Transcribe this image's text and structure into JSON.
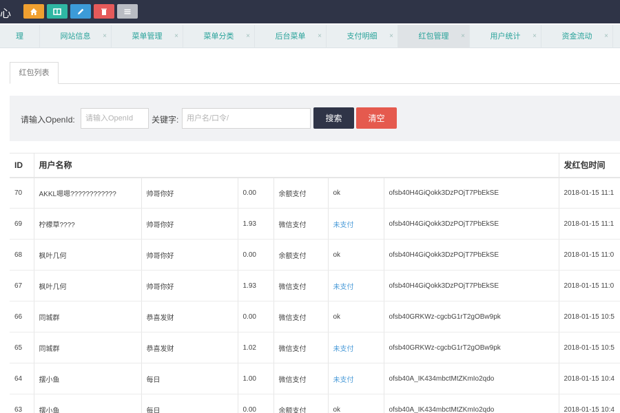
{
  "header": {
    "title": "心"
  },
  "quick_buttons": [
    {
      "icon": "home-icon",
      "color": "#f0a030"
    },
    {
      "icon": "grid-icon",
      "color": "#2fb7a3"
    },
    {
      "icon": "edit-icon",
      "color": "#3c9bd8"
    },
    {
      "icon": "trash-icon",
      "color": "#e55a5a"
    },
    {
      "icon": "menu-icon",
      "color": "#b9bcc3"
    }
  ],
  "tabs": [
    {
      "label": "理"
    },
    {
      "label": "网站信息"
    },
    {
      "label": "菜单管理"
    },
    {
      "label": "菜单分类"
    },
    {
      "label": "后台菜单"
    },
    {
      "label": "支付明细"
    },
    {
      "label": "红包管理",
      "active": true
    },
    {
      "label": "用户统计"
    },
    {
      "label": "资金流动"
    }
  ],
  "subtab": {
    "label": "红包列表"
  },
  "search": {
    "openid_label": "请输入OpenId:",
    "openid_placeholder": "请输入OpenId",
    "keyword_label": "关键字:",
    "keyword_placeholder": "用户名/口令/",
    "search_button": "搜索",
    "clear_button": "清空",
    "search_color": "#2f3447",
    "clear_color": "#e55a4e"
  },
  "table": {
    "headers": {
      "id": "ID",
      "username": "用户名称",
      "time": "发红包时间"
    },
    "rows": [
      {
        "id": "70",
        "username": "AKKL嗯嗯????????????",
        "greeting": "帅哥你好",
        "amount": "0.00",
        "payment": "余额支付",
        "status": "ok",
        "status_unpaid": false,
        "openid": "ofsb40H4GiQokk3DzPOjT7PbEkSE",
        "time": "2018-01-15 11:1"
      },
      {
        "id": "69",
        "username": "柠檬草????",
        "greeting": "帅哥你好",
        "amount": "1.93",
        "payment": "微信支付",
        "status": "未支付",
        "status_unpaid": true,
        "openid": "ofsb40H4GiQokk3DzPOjT7PbEkSE",
        "time": "2018-01-15 11:1"
      },
      {
        "id": "68",
        "username": "枫叶几何",
        "greeting": "帅哥你好",
        "amount": "0.00",
        "payment": "余额支付",
        "status": "ok",
        "status_unpaid": false,
        "openid": "ofsb40H4GiQokk3DzPOjT7PbEkSE",
        "time": "2018-01-15 11:0"
      },
      {
        "id": "67",
        "username": "枫叶几何",
        "greeting": "帅哥你好",
        "amount": "1.93",
        "payment": "微信支付",
        "status": "未支付",
        "status_unpaid": true,
        "openid": "ofsb40H4GiQokk3DzPOjT7PbEkSE",
        "time": "2018-01-15 11:0"
      },
      {
        "id": "66",
        "username": "同城群",
        "greeting": "恭喜发财",
        "amount": "0.00",
        "payment": "微信支付",
        "status": "ok",
        "status_unpaid": false,
        "openid": "ofsb40GRKWz-cgcbG1rT2gOBw9pk",
        "time": "2018-01-15 10:5"
      },
      {
        "id": "65",
        "username": "同城群",
        "greeting": "恭喜发财",
        "amount": "1.02",
        "payment": "微信支付",
        "status": "未支付",
        "status_unpaid": true,
        "openid": "ofsb40GRKWz-cgcbG1rT2gOBw9pk",
        "time": "2018-01-15 10:5"
      },
      {
        "id": "64",
        "username": "摆小鱼",
        "greeting": "每日",
        "amount": "1.00",
        "payment": "微信支付",
        "status": "未支付",
        "status_unpaid": true,
        "openid": "ofsb40A_IK434mbctMtZKmIo2qdo",
        "time": "2018-01-15 10:4"
      },
      {
        "id": "63",
        "username": "摆小鱼",
        "greeting": "每日",
        "amount": "0.00",
        "payment": "余额支付",
        "status": "ok",
        "status_unpaid": false,
        "openid": "ofsb40A_IK434mbctMtZKmIo2qdo",
        "time": "2018-01-15 10:4"
      }
    ]
  }
}
